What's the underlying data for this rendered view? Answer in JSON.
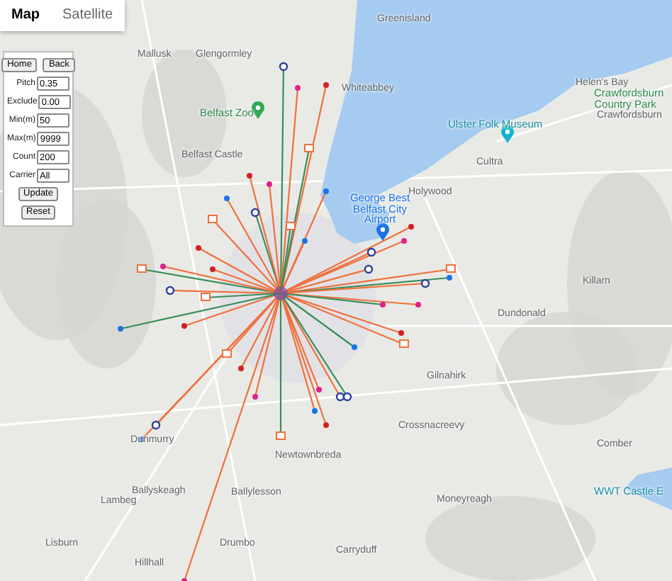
{
  "map_type_tabs": [
    {
      "label": "Map",
      "selected": true
    },
    {
      "label": "Satellite",
      "selected": false
    }
  ],
  "controls": {
    "top_buttons": [
      "Home",
      "Back"
    ],
    "fields": [
      {
        "label": "Pitch",
        "value": "0.35"
      },
      {
        "label": "Exclude",
        "value": "0.00"
      },
      {
        "label": "Min(m)",
        "value": "50"
      },
      {
        "label": "Max(m)",
        "value": "9999"
      },
      {
        "label": "Count",
        "value": "200"
      },
      {
        "label": "Carrier",
        "value": "All"
      }
    ],
    "bottom_buttons": [
      "Update",
      "Reset"
    ]
  },
  "map": {
    "places": [
      {
        "name": "Mallusk",
        "kind": "town"
      },
      {
        "name": "Glengormley",
        "kind": "town"
      },
      {
        "name": "Greenisland",
        "kind": "town"
      },
      {
        "name": "Whiteabbey",
        "kind": "town"
      },
      {
        "name": "Belfast Zoo",
        "kind": "park"
      },
      {
        "name": "Belfast Castle",
        "kind": "town"
      },
      {
        "name": "Helen's Bay",
        "kind": "town"
      },
      {
        "name": "Crawfordsburn Country Park",
        "kind": "park"
      },
      {
        "name": "Crawfordsburn",
        "kind": "town"
      },
      {
        "name": "Ulster Folk Museum",
        "kind": "museum"
      },
      {
        "name": "Cultra",
        "kind": "town"
      },
      {
        "name": "Holywood",
        "kind": "town"
      },
      {
        "name": "George Best Belfast City Airport",
        "kind": "airport"
      },
      {
        "name": "Killarn",
        "kind": "town"
      },
      {
        "name": "Dundonald",
        "kind": "town"
      },
      {
        "name": "Gilnahirk",
        "kind": "town"
      },
      {
        "name": "Crossnacreevy",
        "kind": "town"
      },
      {
        "name": "Comber",
        "kind": "town"
      },
      {
        "name": "WWT Castle E",
        "kind": "museum"
      },
      {
        "name": "Newtownbreda",
        "kind": "town"
      },
      {
        "name": "Dunmurry",
        "kind": "town"
      },
      {
        "name": "Ballyskeagh",
        "kind": "town"
      },
      {
        "name": "Lambeg",
        "kind": "town"
      },
      {
        "name": "Ballylesson",
        "kind": "town"
      },
      {
        "name": "Moneyreagh",
        "kind": "town"
      },
      {
        "name": "Lisburn",
        "kind": "town"
      },
      {
        "name": "Drumbo",
        "kind": "town"
      },
      {
        "name": "Carryduff",
        "kind": "town"
      },
      {
        "name": "Hillhall",
        "kind": "town"
      }
    ]
  }
}
